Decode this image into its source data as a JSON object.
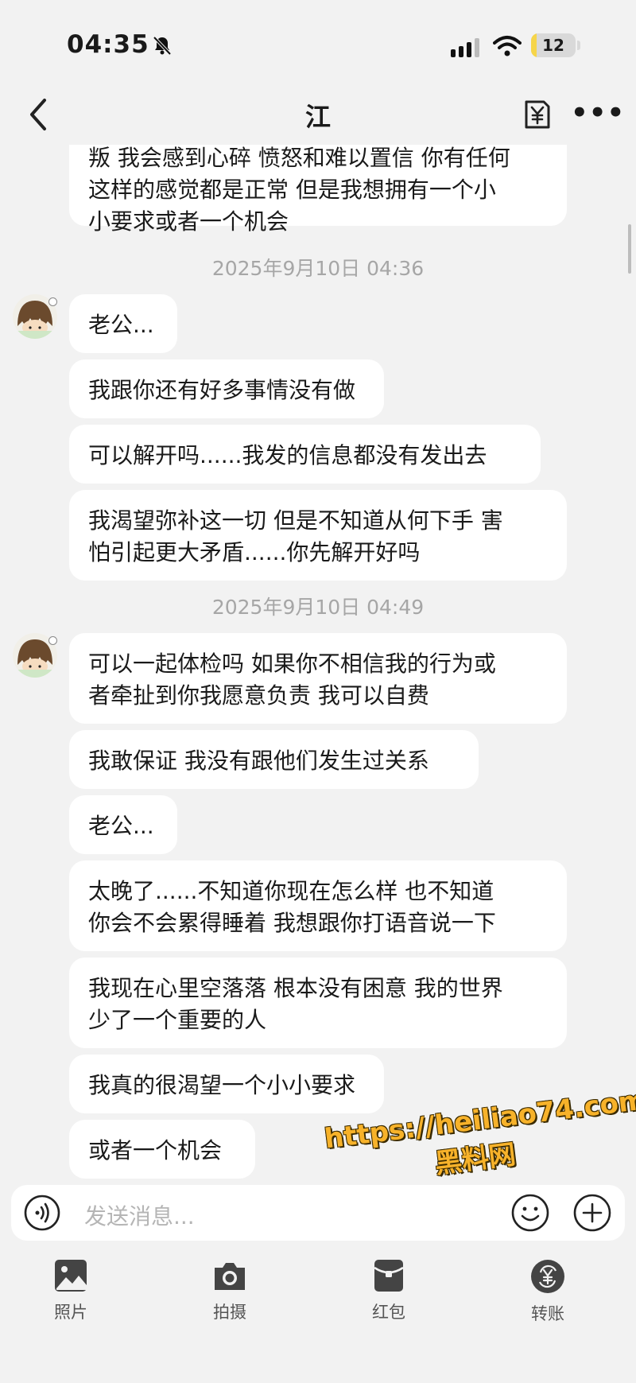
{
  "status": {
    "time": "04:35",
    "battery": "12",
    "battery_level": 0.12
  },
  "nav": {
    "title": "江"
  },
  "messages": [
    {
      "text": "叛 我会感到心碎 愤怒和难以置信 你有任何\n这样的感觉都是正常 但是我想拥有一个小\n小要求或者一个机会"
    },
    {
      "timestamp": "2025年9月10日 04:36"
    },
    {
      "text": "老公..."
    },
    {
      "text": "我跟你还有好多事情没有做"
    },
    {
      "text": "可以解开吗......我发的信息都没有发出去"
    },
    {
      "text": "我渴望弥补这一切 但是不知道从何下手 害\n怕引起更大矛盾......你先解开好吗"
    },
    {
      "timestamp": "2025年9月10日 04:49"
    },
    {
      "text": "可以一起体检吗 如果你不相信我的行为或\n者牵扯到你我愿意负责 我可以自费"
    },
    {
      "text": "我敢保证 我没有跟他们发生过关系"
    },
    {
      "text": "老公..."
    },
    {
      "text": "太晚了......不知道你现在怎么样 也不知道\n你会不会累得睡着 我想跟你打语音说一下"
    },
    {
      "text": "我现在心里空落落 根本没有困意 我的世界\n少了一个重要的人"
    },
    {
      "text": "我真的很渴望一个小小要求"
    },
    {
      "text": "或者一个机会"
    }
  ],
  "input": {
    "placeholder": "发送消息..."
  },
  "toolbar": [
    {
      "label": "照片",
      "icon": "photo-icon"
    },
    {
      "label": "拍摄",
      "icon": "camera-icon"
    },
    {
      "label": "红包",
      "icon": "red-packet-icon"
    },
    {
      "label": "转账",
      "icon": "transfer-icon"
    }
  ],
  "watermark": {
    "line1": "https://heiliao74.com",
    "line2": "黑料网"
  }
}
